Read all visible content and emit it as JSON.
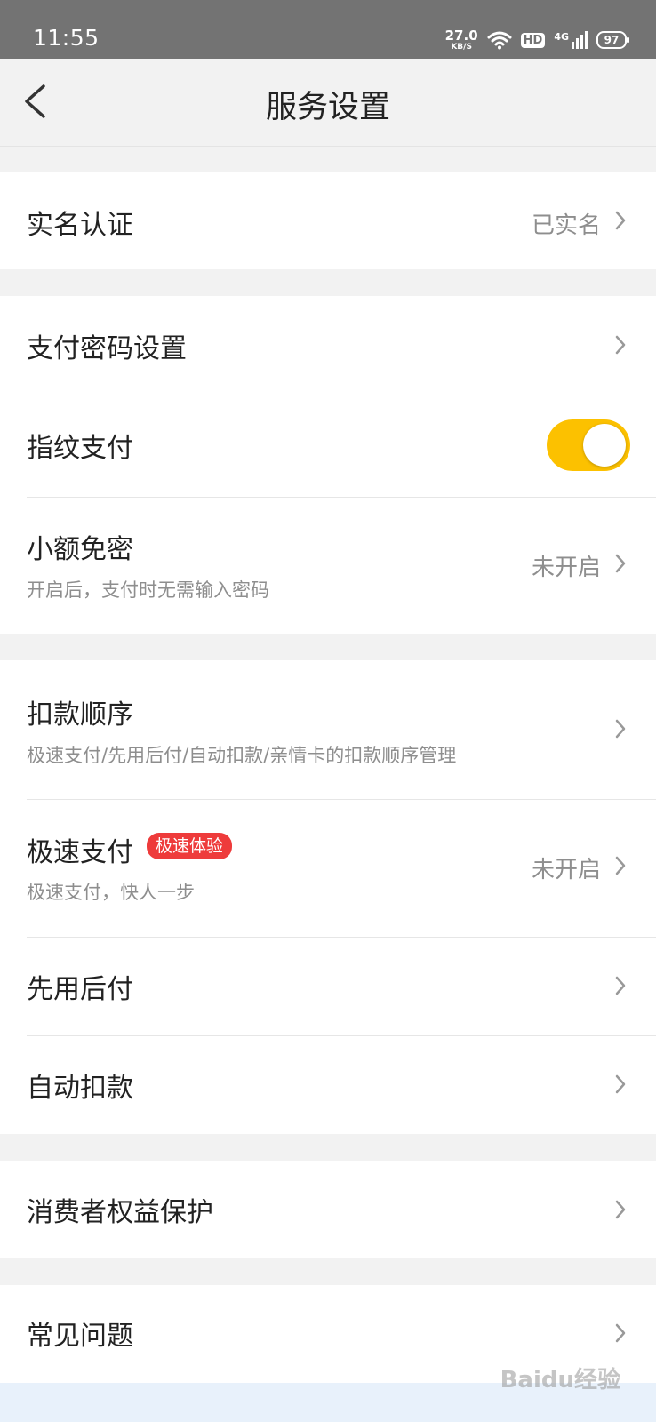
{
  "status_bar": {
    "time": "11:55",
    "speed": "27.0",
    "speed_unit": "KB/S",
    "hd": "HD",
    "network": "4G",
    "battery": "97"
  },
  "header": {
    "title": "服务设置"
  },
  "rows": {
    "real_name": {
      "label": "实名认证",
      "value": "已实名"
    },
    "pay_password": {
      "label": "支付密码设置"
    },
    "fingerprint": {
      "label": "指纹支付",
      "enabled": true
    },
    "small_amount": {
      "label": "小额免密",
      "sub": "开启后，支付时无需输入密码",
      "value": "未开启"
    },
    "deduction_order": {
      "label": "扣款顺序",
      "sub": "极速支付/先用后付/自动扣款/亲情卡的扣款顺序管理"
    },
    "fast_pay": {
      "label": "极速支付",
      "badge": "极速体验",
      "sub": "极速支付，快人一步",
      "value": "未开启"
    },
    "pay_later": {
      "label": "先用后付"
    },
    "auto_deduct": {
      "label": "自动扣款"
    },
    "consumer_rights": {
      "label": "消费者权益保护"
    },
    "faq": {
      "label": "常见问题"
    }
  },
  "watermark": "Baidu经验",
  "colors": {
    "accent": "#fcc100",
    "badge": "#ee3b3b",
    "background": "#f2f2f2"
  }
}
